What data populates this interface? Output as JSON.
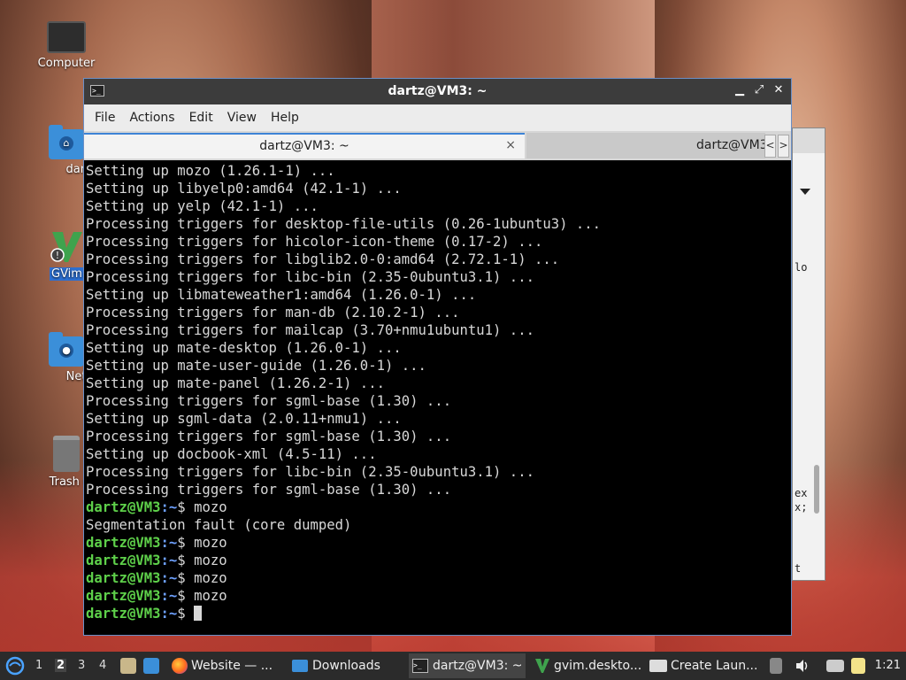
{
  "desktop": {
    "icons": [
      {
        "label": "Computer",
        "icon": "computer-icon"
      },
      {
        "label": "dartz",
        "icon": "home-folder-icon"
      },
      {
        "label": "GVim",
        "icon": "vim-icon"
      },
      {
        "label": "Netwo",
        "icon": "network-folder-icon"
      },
      {
        "label": "Trash (Em",
        "icon": "trash-icon"
      }
    ]
  },
  "background_window": {
    "text_lines": [
      "lo",
      "ex",
      "x;",
      "t"
    ]
  },
  "terminal": {
    "title": "dartz@VM3: ~",
    "menu": [
      "File",
      "Actions",
      "Edit",
      "View",
      "Help"
    ],
    "tabs": [
      {
        "label": "dartz@VM3: ~",
        "active": true
      },
      {
        "label": "dartz@VM3",
        "active": false
      }
    ],
    "tab_close": "×",
    "tab_nav_prev": "<",
    "tab_nav_next": ">",
    "lines": [
      "Setting up mozo (1.26.1-1) ...",
      "Setting up libyelp0:amd64 (42.1-1) ...",
      "Setting up yelp (42.1-1) ...",
      "Processing triggers for desktop-file-utils (0.26-1ubuntu3) ...",
      "Processing triggers for hicolor-icon-theme (0.17-2) ...",
      "Processing triggers for libglib2.0-0:amd64 (2.72.1-1) ...",
      "Processing triggers for libc-bin (2.35-0ubuntu3.1) ...",
      "Setting up libmateweather1:amd64 (1.26.0-1) ...",
      "Processing triggers for man-db (2.10.2-1) ...",
      "Processing triggers for mailcap (3.70+nmu1ubuntu1) ...",
      "Setting up mate-desktop (1.26.0-1) ...",
      "Setting up mate-user-guide (1.26.0-1) ...",
      "Setting up mate-panel (1.26.2-1) ...",
      "Processing triggers for sgml-base (1.30) ...",
      "Setting up sgml-data (2.0.11+nmu1) ...",
      "Processing triggers for sgml-base (1.30) ...",
      "Setting up docbook-xml (4.5-11) ...",
      "Processing triggers for libc-bin (2.35-0ubuntu3.1) ...",
      "Processing triggers for sgml-base (1.30) ..."
    ],
    "prompt_user": "dartz@VM3",
    "prompt_path": ":~",
    "prompt_sym": "$ ",
    "session": [
      {
        "cmd": "mozo",
        "output": "Segmentation fault (core dumped)"
      },
      {
        "cmd": "mozo",
        "output": null
      },
      {
        "cmd": "mozo",
        "output": null
      },
      {
        "cmd": "mozo",
        "output": null
      },
      {
        "cmd": "mozo",
        "output": null
      }
    ]
  },
  "taskbar": {
    "workspaces": [
      "1",
      "2",
      "3",
      "4"
    ],
    "current_workspace": "2",
    "tasks": [
      {
        "label": "Website — ...",
        "icon": "firefox-icon"
      },
      {
        "label": "Downloads",
        "icon": "folder-icon"
      },
      {
        "label": "dartz@VM3: ~",
        "icon": "terminal-icon"
      },
      {
        "label": "gvim.deskto...",
        "icon": "vim-icon"
      },
      {
        "label": "Create Laun...",
        "icon": "launcher-icon"
      }
    ],
    "clock": "1:21",
    "colors": {
      "accent": "#3d83d6",
      "prompt_green": "#5ed04a",
      "prompt_blue": "#6ea1ff"
    }
  }
}
